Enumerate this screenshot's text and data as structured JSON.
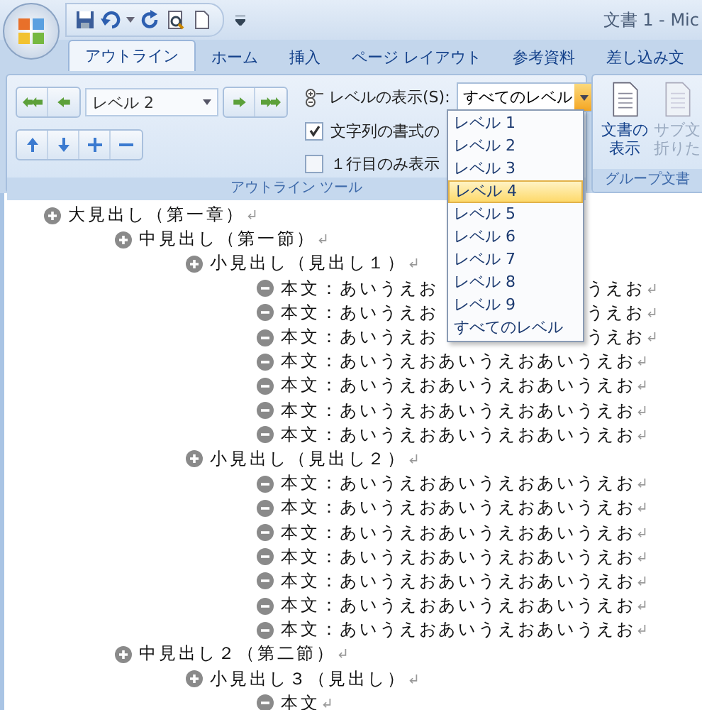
{
  "window": {
    "title": "文書 1 - Mic"
  },
  "tabs": [
    {
      "label": "アウトライン",
      "selected": true
    },
    {
      "label": "ホーム",
      "selected": false
    },
    {
      "label": "挿入",
      "selected": false
    },
    {
      "label": "ページ レイアウト",
      "selected": false
    },
    {
      "label": "参考資料",
      "selected": false
    },
    {
      "label": "差し込み文",
      "selected": false
    }
  ],
  "outline_tools": {
    "level_combo": {
      "value": "レベル 2"
    },
    "show_level": {
      "label": "レベルの表示(S):",
      "value": "すべてのレベル"
    },
    "checkboxes": [
      {
        "label": "文字列の書式の",
        "checked": true
      },
      {
        "label": "１行目のみ表示",
        "checked": false
      }
    ],
    "group_label": "アウトライン ツール"
  },
  "master_document": {
    "buttons": [
      {
        "label": "文書の",
        "label_2": "表示",
        "disabled": false
      },
      {
        "label": "サブ文",
        "label_2": "折りた",
        "disabled": true
      }
    ],
    "group_label": "グループ文書"
  },
  "level_menu": [
    {
      "label": "レベル 1",
      "selected": false
    },
    {
      "label": "レベル 2",
      "selected": false
    },
    {
      "label": "レベル 3",
      "selected": false
    },
    {
      "label": "レベル 4",
      "selected": true
    },
    {
      "label": "レベル 5",
      "selected": false
    },
    {
      "label": "レベル 6",
      "selected": false
    },
    {
      "label": "レベル 7",
      "selected": false
    },
    {
      "label": "レベル 8",
      "selected": false
    },
    {
      "label": "レベル 9",
      "selected": false
    },
    {
      "label": "すべてのレベル",
      "selected": false
    }
  ],
  "outline": [
    {
      "kind": "heading",
      "text": "大見出し（第一章）",
      "children": [
        {
          "kind": "heading",
          "text": "中見出し（第一節）",
          "children": [
            {
              "kind": "heading",
              "text": "小見出し（見出し１）",
              "children": [
                {
                  "kind": "body",
                  "text": "本文：あいうえお",
                  "text_end": "うえお"
                },
                {
                  "kind": "body",
                  "text": "本文：あいうえお",
                  "text_end": "うえお"
                },
                {
                  "kind": "body",
                  "text": "本文：あいうえお",
                  "text_end": "うえお"
                },
                {
                  "kind": "body",
                  "text": "本文：あいうえおあいうえおあいうえお"
                },
                {
                  "kind": "body",
                  "text": "本文：あいうえおあいうえおあいうえお"
                },
                {
                  "kind": "body",
                  "text": "本文：あいうえおあいうえおあいうえお"
                },
                {
                  "kind": "body",
                  "text": "本文：あいうえおあいうえおあいうえお"
                }
              ]
            },
            {
              "kind": "heading",
              "text": "小見出し（見出し２）",
              "children": [
                {
                  "kind": "body",
                  "text": "本文：あいうえおあいうえおあいうえお"
                },
                {
                  "kind": "body",
                  "text": "本文：あいうえおあいうえおあいうえお"
                },
                {
                  "kind": "body",
                  "text": "本文：あいうえおあいうえおあいうえお"
                },
                {
                  "kind": "body",
                  "text": "本文：あいうえおあいうえおあいうえお"
                },
                {
                  "kind": "body",
                  "text": "本文：あいうえおあいうえおあいうえお"
                },
                {
                  "kind": "body",
                  "text": "本文：あいうえおあいうえおあいうえお"
                },
                {
                  "kind": "body",
                  "text": "本文：あいうえおあいうえおあいうえお"
                }
              ]
            }
          ]
        },
        {
          "kind": "heading",
          "text": "中見出し２（第二節）",
          "children": [
            {
              "kind": "heading",
              "text": "小見出し３（見出し）",
              "children": [
                {
                  "kind": "body",
                  "text": "本文"
                }
              ]
            }
          ]
        }
      ]
    }
  ]
}
